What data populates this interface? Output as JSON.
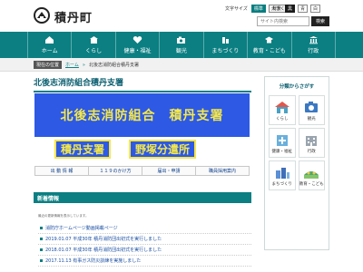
{
  "header": {
    "site_name": "積丹町",
    "text_size_label": "文字サイズ",
    "text_size_buttons": [
      "標準",
      "大きく"
    ],
    "bg_color_label": "背景",
    "bg_buttons": [
      "黒",
      "青",
      "白"
    ],
    "search_placeholder": "サイト内検索",
    "search_button": "検索"
  },
  "nav": {
    "items": [
      {
        "label": "ホーム",
        "icon": "home-icon"
      },
      {
        "label": "くらし",
        "icon": "house-icon"
      },
      {
        "label": "健康・福祉",
        "icon": "heart-icon"
      },
      {
        "label": "観光",
        "icon": "camera-icon"
      },
      {
        "label": "まちづくり",
        "icon": "building-icon"
      },
      {
        "label": "教育・こども",
        "icon": "school-icon"
      },
      {
        "label": "行政",
        "icon": "city-hall-icon"
      }
    ]
  },
  "breadcrumb": {
    "tag": "現在の位置",
    "home": "ホーム",
    "current": "北後志消防組合積丹支署"
  },
  "main": {
    "title": "北後志消防組合積丹支署",
    "banner": "北後志消防組合　積丹支署",
    "sub_banners": [
      "積丹支署",
      "野塚分遣所"
    ],
    "tabs": [
      "出 動 情 報",
      "１１９のかけ方",
      "届出・申請",
      "職員採用案内"
    ]
  },
  "news": {
    "heading": "新着情報",
    "note": "最近の更新情報を表示しています。",
    "items": [
      "消防庁ホームページ動画掲載ページ",
      "2019.01.07 平成30年 積丹消防団出初式を実行しました",
      "2018.01.07 平成30年 積丹消防団出初式を実行しました",
      "2017.11.13 有事ガス防災訓練を実施しました"
    ]
  },
  "sidebar": {
    "title": "分類からさがす",
    "items": [
      {
        "label": "くらし",
        "icon": "life-icon"
      },
      {
        "label": "観光",
        "icon": "sightseeing-icon"
      },
      {
        "label": "健康・福祉",
        "icon": "health-icon"
      },
      {
        "label": "行政",
        "icon": "admin-icon"
      },
      {
        "label": "まちづくり",
        "icon": "town-icon"
      },
      {
        "label": "教育・こども",
        "icon": "education-icon"
      }
    ]
  },
  "colors": {
    "accent": "#0b7f82",
    "banner_blue": "#2d59e4",
    "banner_yellow": "#f5e84b"
  }
}
